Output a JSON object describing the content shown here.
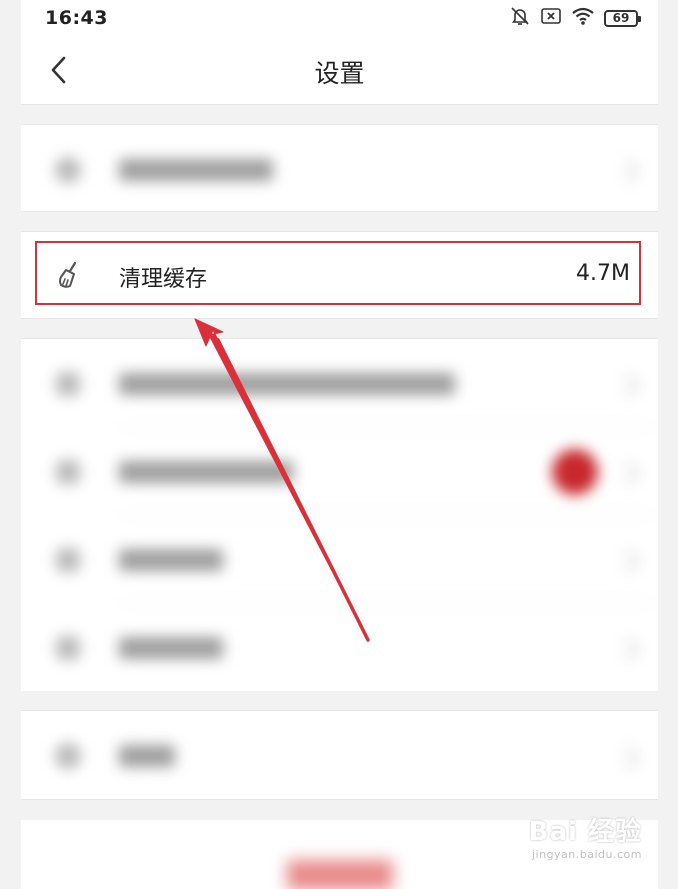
{
  "status_bar": {
    "time": "16:43",
    "battery": "69",
    "icons": [
      "bell-off-icon",
      "sim-off-icon",
      "wifi-icon",
      "battery-icon"
    ]
  },
  "header": {
    "title": "设置",
    "back_icon": "chevron-left-icon"
  },
  "settings": {
    "cache_item": {
      "label": "清理缓存",
      "value": "4.7M",
      "icon": "broom-icon"
    }
  },
  "annotation": {
    "highlight_color": "#d9303a",
    "arrow_color": "#d9303a"
  },
  "watermark": {
    "brand": "Bai 经验",
    "url": "jingyan.baidu.com"
  }
}
